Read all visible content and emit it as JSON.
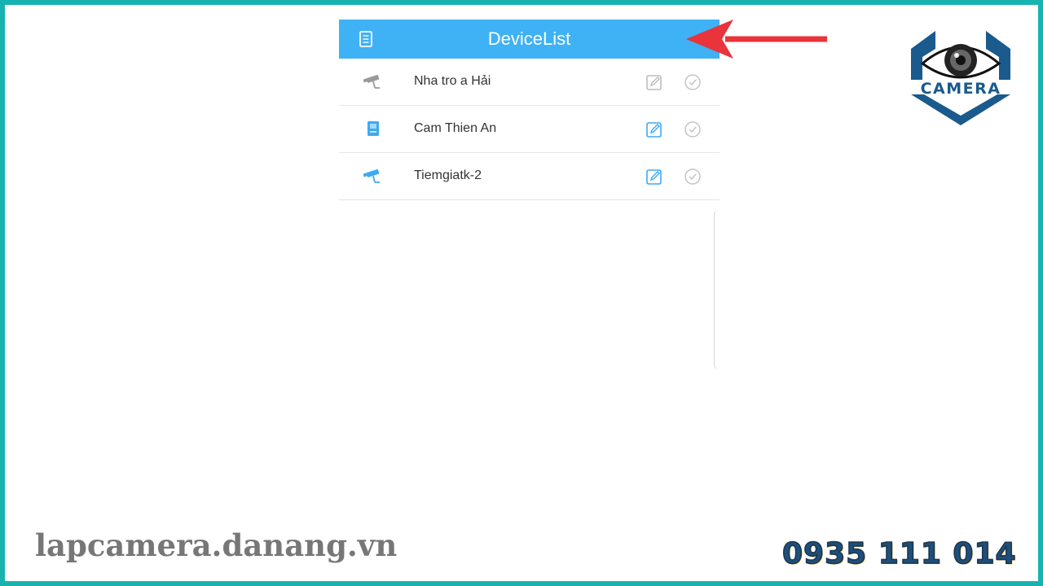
{
  "app": {
    "title": "DeviceList",
    "devices": [
      {
        "name": "Nha tro a Hải",
        "icon": "camera-icon",
        "active": false
      },
      {
        "name": "Cam Thien An",
        "icon": "dvr-box-icon",
        "active": true
      },
      {
        "name": "Tiemgiatk-2",
        "icon": "camera-icon",
        "active": true
      }
    ]
  },
  "branding": {
    "logo_text": "CAMERA",
    "website": "lapcamera.danang.vn",
    "phone": "0935 111 014"
  },
  "colors": {
    "header": "#3fb1f5",
    "frame": "#17b3b0",
    "arrow": "#e8343a",
    "logo_blue": "#1a5a8c"
  }
}
